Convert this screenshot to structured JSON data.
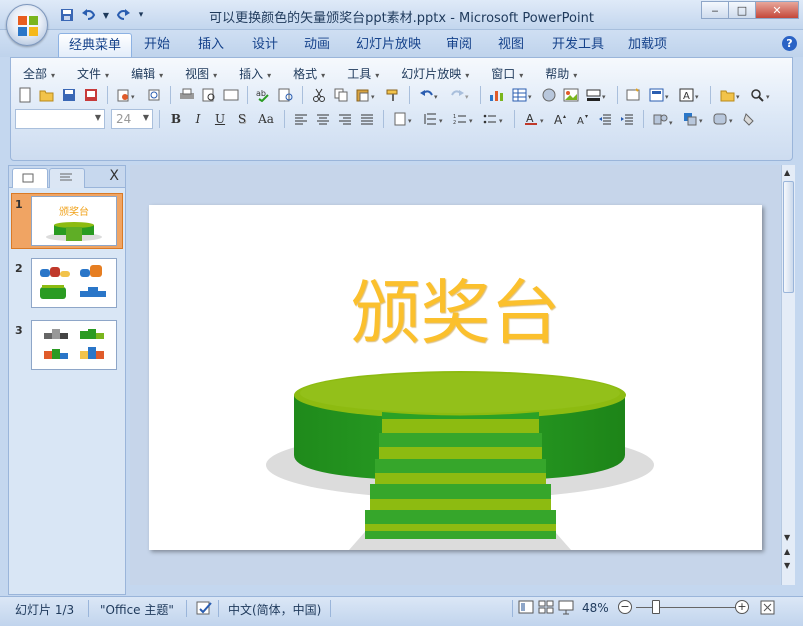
{
  "window": {
    "title": "可以更换颜色的矢量颁奖台ppt素材.pptx - Microsoft PowerPoint",
    "minimize_label": "‒",
    "maximize_label": "□",
    "close_label": "✕"
  },
  "quick_access": [
    "save-icon",
    "undo-icon",
    "redo-icon",
    "customize-icon"
  ],
  "ribbon_tabs": [
    {
      "label": "经典菜单",
      "active": true
    },
    {
      "label": "开始"
    },
    {
      "label": "插入"
    },
    {
      "label": "设计"
    },
    {
      "label": "动画"
    },
    {
      "label": "幻灯片放映"
    },
    {
      "label": "审阅"
    },
    {
      "label": "视图"
    },
    {
      "label": "开发工具"
    },
    {
      "label": "加载项"
    }
  ],
  "help_label": "?",
  "classic_menu": [
    "全部",
    "文件",
    "编辑",
    "视图",
    "插入",
    "格式",
    "工具",
    "幻灯片放映",
    "窗口",
    "帮助"
  ],
  "format_bar": {
    "font_name": "",
    "font_size": "24",
    "bold": "B",
    "italic": "I",
    "underline": "U",
    "shadow": "S",
    "case": "Aa"
  },
  "slides_panel": {
    "tab_slides_icon": "slide-icon",
    "tab_outline_icon": "outline-icon",
    "close_label": "X",
    "slides": [
      {
        "number": "1",
        "selected": true,
        "title": "颁奖台"
      },
      {
        "number": "2"
      },
      {
        "number": "3"
      }
    ]
  },
  "slide": {
    "title": "颁奖台",
    "podium_color": "#2a9b22",
    "podium_top_color": "#8dbb11",
    "title_color": "#fbc02d"
  },
  "status_bar": {
    "slide_info": "幻灯片 1/3",
    "theme": "\"Office 主题\"",
    "language": "中文(简体，中国)",
    "zoom": "48%"
  }
}
